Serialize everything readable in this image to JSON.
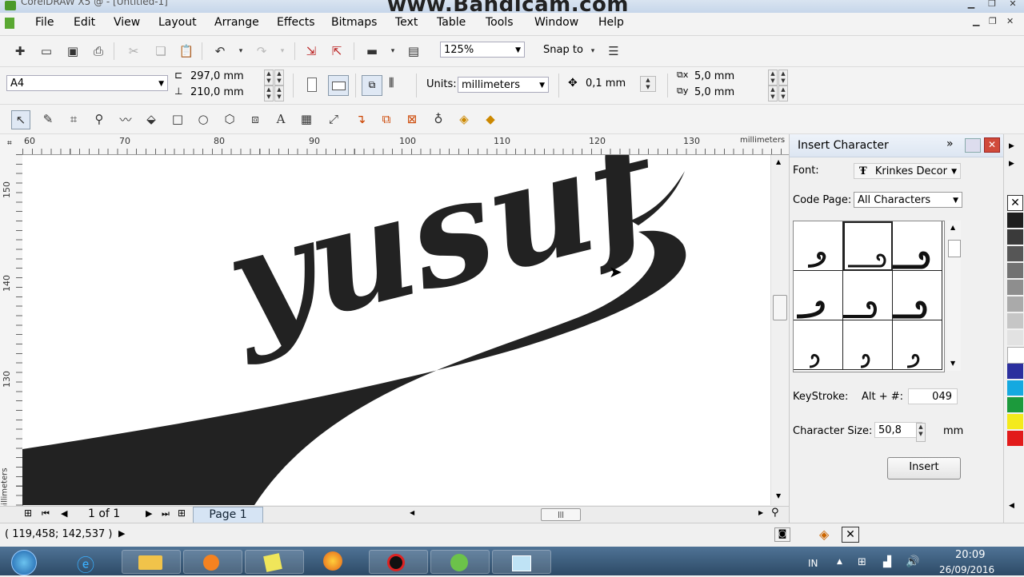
{
  "window": {
    "app_title": "CorelDRAW X5 @ - [Untitled-1]",
    "watermark": "www.Bandicam.com"
  },
  "menu": [
    "File",
    "Edit",
    "View",
    "Layout",
    "Arrange",
    "Effects",
    "Bitmaps",
    "Text",
    "Table",
    "Tools",
    "Window",
    "Help"
  ],
  "toolbar": {
    "zoom": "125%",
    "snap_to": "Snap to"
  },
  "property_bar": {
    "page_size": "A4",
    "width": "297,0 mm",
    "height": "210,0 mm",
    "units_label": "Units:",
    "units_value": "millimeters",
    "nudge": "0,1 mm",
    "dup_x": "5,0 mm",
    "dup_y": "5,0 mm"
  },
  "ruler_h": {
    "ticks": [
      "60",
      "70",
      "80",
      "90",
      "100",
      "110",
      "120",
      "130"
    ],
    "unit": "millimeters"
  },
  "ruler_v": {
    "ticks": [
      "150",
      "140",
      "130"
    ],
    "unit": "millimeters"
  },
  "canvas": {
    "artwork_text": "yusuf"
  },
  "page_nav": {
    "counter": "1 of 1",
    "tab": "Page 1"
  },
  "status": {
    "coords": "( 119,458; 142,537 )"
  },
  "docker": {
    "title": "Insert Character",
    "font_label": "Font:",
    "font_value": "Krinkes Decor",
    "codepage_label": "Code Page:",
    "codepage_value": "All Characters",
    "keystroke_label": "KeyStroke:",
    "alt_label": "Alt + #:",
    "keystroke_value": "049",
    "charsize_label": "Character Size:",
    "charsize_value": "50,8",
    "charsize_unit": "mm",
    "insert_button": "Insert"
  },
  "palette_colors": [
    "#1e1e1e",
    "#3a3a3a",
    "#565656",
    "#727272",
    "#8e8e8e",
    "#aaaaaa",
    "#c6c6c6",
    "#e2e2e2",
    "#ffffff",
    "#2b2f9e",
    "#15a9e0",
    "#1c9a3c",
    "#f4ea1c",
    "#e21b1b"
  ],
  "taskbar": {
    "lang": "IN",
    "time": "20:09",
    "date": "26/09/2016"
  }
}
